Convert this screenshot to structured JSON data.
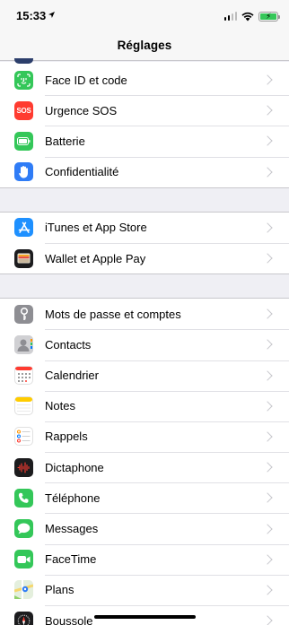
{
  "status": {
    "time": "15:33"
  },
  "nav": {
    "title": "Réglages"
  },
  "groups": [
    [
      {
        "label": "Face ID et code",
        "icon": "face-id-icon",
        "color": "#34c759"
      },
      {
        "label": "Urgence SOS",
        "icon": "sos-icon",
        "color": "#ff3b30",
        "text": "SOS"
      },
      {
        "label": "Batterie",
        "icon": "battery-icon",
        "color": "#34c759"
      },
      {
        "label": "Confidentialité",
        "icon": "hand-icon",
        "color": "#2f7cf6"
      }
    ],
    [
      {
        "label": "iTunes et App Store",
        "icon": "app-store-icon",
        "color": "#1e90ff"
      },
      {
        "label": "Wallet et Apple Pay",
        "icon": "wallet-icon",
        "color": "#1c1c1e"
      }
    ],
    [
      {
        "label": "Mots de passe et comptes",
        "icon": "key-icon",
        "color": "#8e8e93"
      },
      {
        "label": "Contacts",
        "icon": "contacts-icon",
        "color": "#c8c8cc"
      },
      {
        "label": "Calendrier",
        "icon": "calendar-icon",
        "color": "#ffffff"
      },
      {
        "label": "Notes",
        "icon": "notes-icon",
        "color": "#ffffff"
      },
      {
        "label": "Rappels",
        "icon": "reminders-icon",
        "color": "#ffffff"
      },
      {
        "label": "Dictaphone",
        "icon": "voice-memo-icon",
        "color": "#1c1c1e"
      },
      {
        "label": "Téléphone",
        "icon": "phone-icon",
        "color": "#34c759"
      },
      {
        "label": "Messages",
        "icon": "messages-icon",
        "color": "#34c759"
      },
      {
        "label": "FaceTime",
        "icon": "facetime-icon",
        "color": "#34c759"
      },
      {
        "label": "Plans",
        "icon": "maps-icon",
        "color": "#e8f0e4"
      },
      {
        "label": "Boussole",
        "icon": "compass-icon",
        "color": "#1c1c1e"
      }
    ]
  ]
}
